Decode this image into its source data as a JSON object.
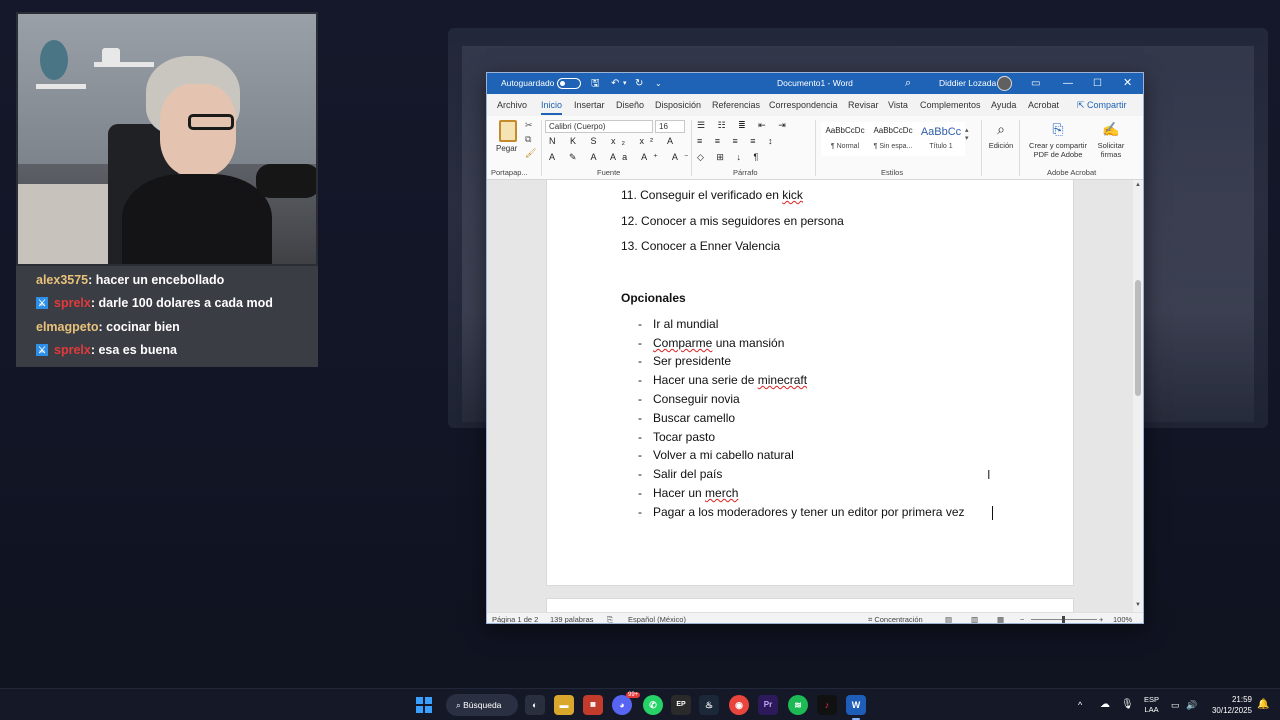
{
  "chat": {
    "messages": [
      {
        "user": "alex3575",
        "text": ": hacer un encebollado",
        "mod": false
      },
      {
        "user": "sprelx",
        "text": ": darle 100 dolares a cada mod",
        "mod": true
      },
      {
        "user": "elmagpeto",
        "text": ": cocinar bien",
        "mod": false
      },
      {
        "user": "sprelx",
        "text": ": esa es buena",
        "mod": true
      }
    ]
  },
  "word": {
    "autosave_label": "Autoguardado",
    "title": "Documento1  -  Word",
    "user_name": "Diddier Lozada",
    "menu": [
      "Archivo",
      "Inicio",
      "Insertar",
      "Diseño",
      "Disposición",
      "Referencias",
      "Correspondencia",
      "Revisar",
      "Vista",
      "Complementos",
      "Ayuda",
      "Acrobat"
    ],
    "share_label": "Compartir",
    "ribbon": {
      "paste_label": "Pegar",
      "clipboard_group": "Portapap...",
      "font_name": "Calibri (Cuerpo)",
      "font_size": "16",
      "font_group": "Fuente",
      "paragraph_group": "Párrafo",
      "styles": [
        {
          "preview": "AaBbCcDc",
          "name": "¶ Normal"
        },
        {
          "preview": "AaBbCcDc",
          "name": "¶ Sin espa..."
        },
        {
          "preview": "AaBbCc",
          "name": "Título 1"
        }
      ],
      "styles_group": "Estilos",
      "edit_label": "Edición",
      "acrobat_create": "Crear y compartir PDF de Adobe",
      "acrobat_sign": "Solicitar firmas",
      "acrobat_group": "Adobe Acrobat"
    },
    "document": {
      "numbered": [
        {
          "num": "11.",
          "pre": "Conseguir el verificado en ",
          "squiggle": "kick",
          "post": ""
        },
        {
          "num": "12.",
          "pre": "Conocer a mis seguidores en persona",
          "squiggle": "",
          "post": ""
        },
        {
          "num": "13.",
          "pre": "Conocer a Enner Valencia",
          "squiggle": "",
          "post": ""
        }
      ],
      "heading": "Opcionales",
      "optional": [
        {
          "pre": "Ir al mundial",
          "squiggle": "",
          "post": ""
        },
        {
          "pre": "",
          "squiggle": "Comparme",
          "post": " una mansión"
        },
        {
          "pre": "Ser presidente",
          "squiggle": "",
          "post": ""
        },
        {
          "pre": "Hacer una serie de ",
          "squiggle": "minecraft",
          "post": ""
        },
        {
          "pre": "Conseguir novia",
          "squiggle": "",
          "post": ""
        },
        {
          "pre": "Buscar camello",
          "squiggle": "",
          "post": ""
        },
        {
          "pre": "Tocar pasto",
          "squiggle": "",
          "post": ""
        },
        {
          "pre": "Volver a mi cabello natural",
          "squiggle": "",
          "post": ""
        },
        {
          "pre": "Salir del país",
          "squiggle": "",
          "post": ""
        },
        {
          "pre": "Hacer un ",
          "squiggle": "merch",
          "post": ""
        },
        {
          "pre": "Pagar a los moderadores y tener un editor por primera vez",
          "squiggle": "",
          "post": ""
        }
      ]
    },
    "status": {
      "page": "Página 1 de 2",
      "words": "139 palabras",
      "language": "Español (México)",
      "focus": "Concentración",
      "zoom": "100%"
    }
  },
  "taskbar": {
    "search_label": "Búsqueda",
    "lang_top": "ESP",
    "lang_bottom": "LAA",
    "time": "21:59",
    "date": "30/12/2025",
    "notif_count": "99+"
  }
}
